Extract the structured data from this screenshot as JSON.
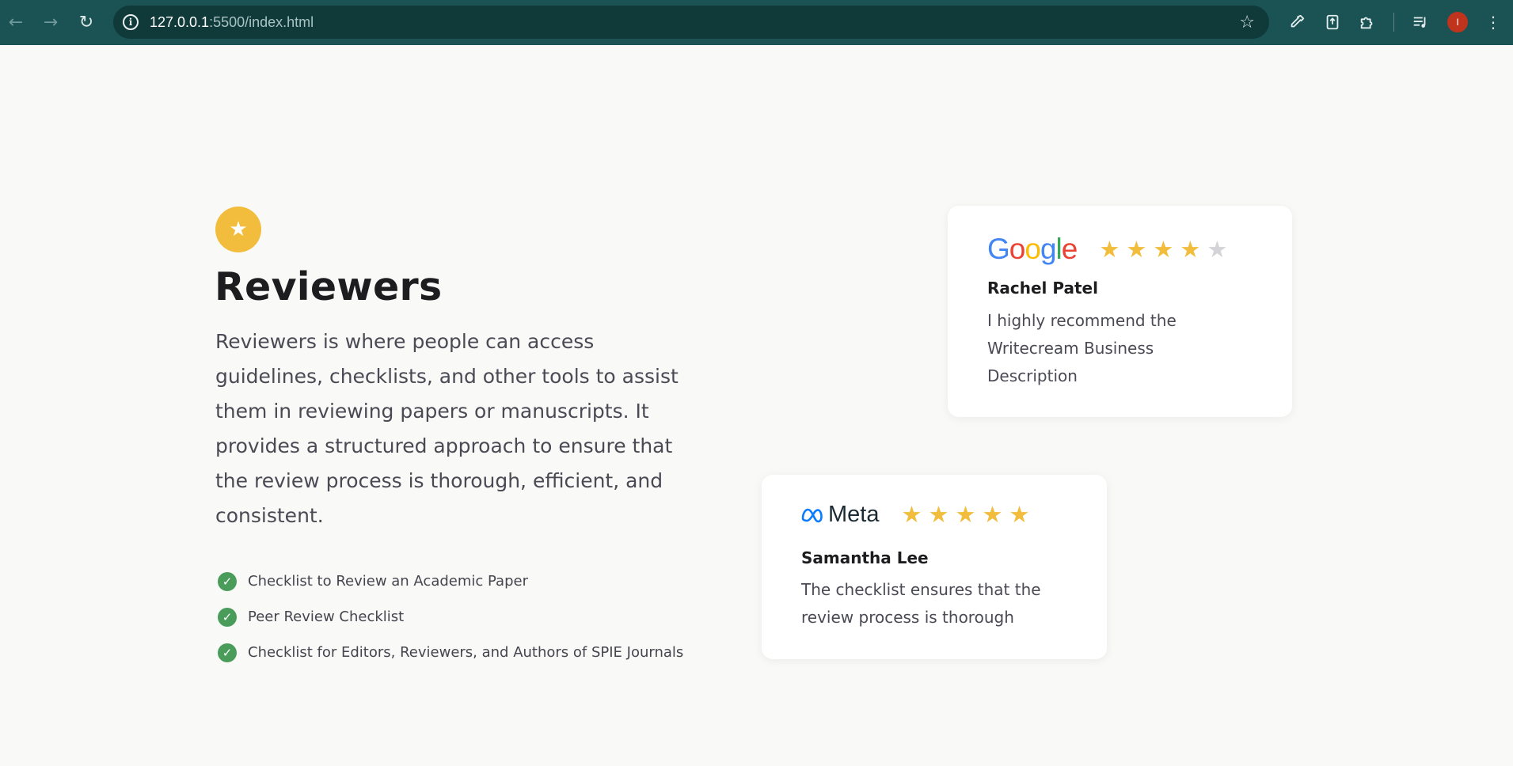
{
  "browser": {
    "url_host": "127.0.0.1",
    "url_path": ":5500/index.html",
    "profile_initial": "I",
    "icons": [
      "back-arrow-icon",
      "forward-arrow-icon",
      "reload-icon",
      "site-info-icon",
      "bookmark-star-icon",
      "eyedropper-icon",
      "extension-icon",
      "puzzle-icon",
      "reading-list-icon",
      "menu-dots-icon"
    ]
  },
  "section": {
    "badge_icon": "star-icon",
    "title": "Reviewers",
    "description": "Reviewers is where people can access guidelines, checklists, and other tools to assist them in reviewing papers or manuscripts. It provides a structured approach to ensure that the review process is thorough, efficient, and consistent.",
    "checklist": [
      "Checklist to Review an Academic Paper",
      "Peer Review Checklist",
      "Checklist for Editors, Reviewers, and Authors of SPIE Journals"
    ]
  },
  "reviews": [
    {
      "platform": "Google",
      "rating": 4,
      "max_rating": 5,
      "name": "Rachel Patel",
      "quote": "I highly recommend the Writecream Business Description"
    },
    {
      "platform": "Meta",
      "rating": 5,
      "max_rating": 5,
      "name": "Samantha Lee",
      "quote": "The checklist ensures that the review process is thorough"
    }
  ],
  "colors": {
    "chrome_bg": "#1b5253",
    "page_bg": "#f9f9f7",
    "accent_yellow": "#f2bd3c",
    "check_green": "#4a9c5b",
    "text_dark": "#1d1d1f",
    "text_body": "#4a4a55"
  }
}
